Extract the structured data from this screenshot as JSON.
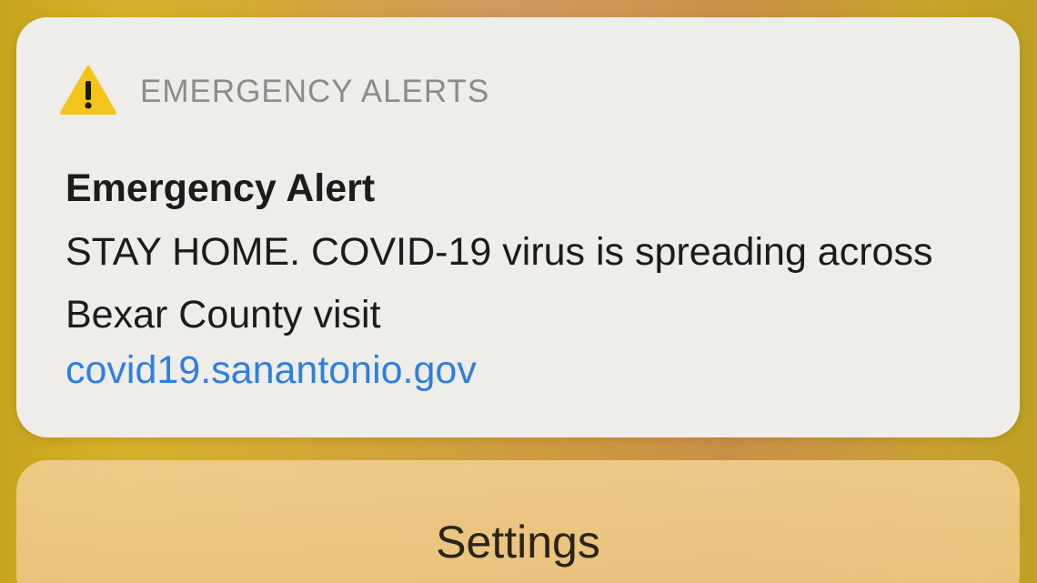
{
  "notification": {
    "app_name": "EMERGENCY ALERTS",
    "icon": "warning-triangle-icon",
    "title": "Emergency Alert",
    "body": "STAY HOME. COVID-19 virus is spreading across Bexar County visit",
    "link": "covid19.sanantonio.gov"
  },
  "actions": {
    "settings_label": "Settings"
  },
  "colors": {
    "warning_yellow": "#f3c51a",
    "link_blue": "#2f7fe0",
    "card_background": "#efedea"
  }
}
